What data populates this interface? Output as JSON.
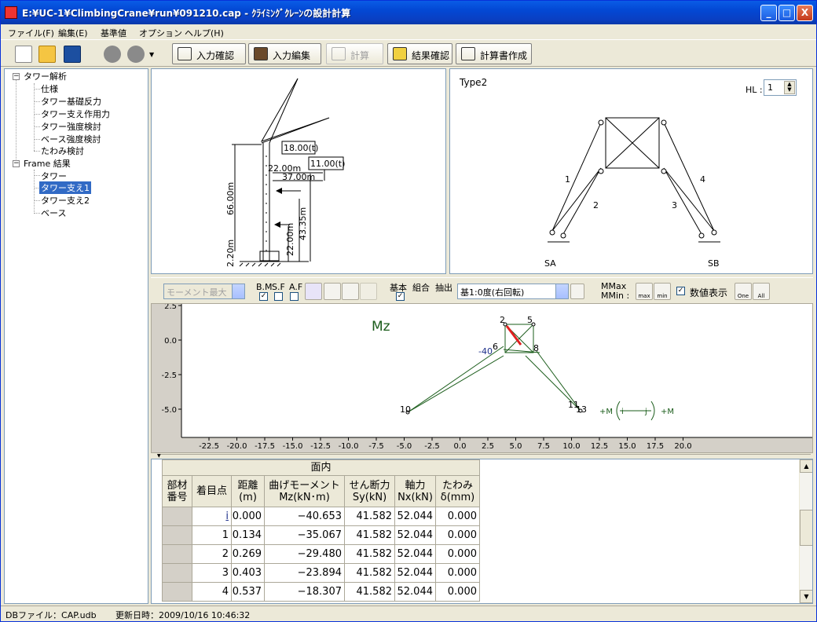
{
  "window": {
    "title": "E:¥UC-1¥ClimbingCrane¥run¥091210.cap - ｸﾗｲﾐﾝｸﾞｸﾚｰﾝの設計計算",
    "min": "_",
    "max": "□",
    "close": "X"
  },
  "menu": {
    "file": "ファイル(F)",
    "edit": "編集(E)",
    "base": "基準値",
    "options": "オプション",
    "help": "ヘルプ(H)"
  },
  "toolbar": {
    "input_check": "入力確認",
    "input_edit": "入力編集",
    "calc": "計算",
    "result_check": "結果確認",
    "report": "計算書作成"
  },
  "tree": {
    "root1": "タワー解析",
    "children1": [
      "仕様",
      "タワー基礎反力",
      "タワー支え作用力",
      "タワー強度検討",
      "ベース強度検討",
      "たわみ検討"
    ],
    "root2": "Frame 結果",
    "children2": [
      "タワー",
      "タワー支え1",
      "タワー支え2",
      "ベース"
    ],
    "selected": "タワー支え1"
  },
  "crane": {
    "load1": "18.00(t)",
    "load2": "11.00(t)",
    "r1": "22.00m",
    "r2": "37.00m",
    "h_total": "66.00m",
    "h_support": "43.35m",
    "h_lower": "22.00m",
    "h_base": "2.20m"
  },
  "frame": {
    "type": "Type2",
    "hl_label": "HL :",
    "hl_value": "1",
    "members": [
      "1",
      "2",
      "3",
      "4"
    ],
    "supports": [
      "SA",
      "SB"
    ]
  },
  "result_toolbar": {
    "moment_combo": "モーメント最大",
    "bm": "B.M",
    "sf": "S.F",
    "af": "A.F",
    "basic": "基本",
    "combo": "組合",
    "extract": "抽出",
    "case": "基1:0度(右回転)",
    "mmax": "MMax",
    "mmin": "MMin :",
    "show_values": "数値表示",
    "max": "max",
    "min": "min",
    "one": "One",
    "all": "All"
  },
  "plot": {
    "label": "Mz",
    "y_ticks": [
      "2.5",
      "0.0",
      "-2.5",
      "-5.0"
    ],
    "x_ticks": [
      "-22.5",
      "-20.0",
      "-17.5",
      "-15.0",
      "-12.5",
      "-10.0",
      "-7.5",
      "-5.0",
      "-2.5",
      "0.0",
      "2.5",
      "5.0",
      "7.5",
      "10.0",
      "12.5",
      "15.0",
      "17.5",
      "20.0"
    ],
    "node_labels": [
      "2",
      "5",
      "-40",
      "6",
      "8",
      "10",
      "11",
      "13"
    ],
    "legend_left": "+M",
    "legend_i": "i",
    "legend_j": "j",
    "legend_right": "+M"
  },
  "table": {
    "group": "面内",
    "headers": [
      "部材\n番号",
      "着目点",
      "距離\n(m)",
      "曲げモーメント\nMz(kN･m)",
      "せん断力\nSy(kN)",
      "軸力\nNx(kN)",
      "たわみ\nδ(mm)"
    ],
    "rows": [
      {
        "point": "i",
        "dist": "0.000",
        "mz": "−40.653",
        "sy": "41.582",
        "nx": "52.044",
        "d": "0.000"
      },
      {
        "point": "1",
        "dist": "0.134",
        "mz": "−35.067",
        "sy": "41.582",
        "nx": "52.044",
        "d": "0.000"
      },
      {
        "point": "2",
        "dist": "0.269",
        "mz": "−29.480",
        "sy": "41.582",
        "nx": "52.044",
        "d": "0.000"
      },
      {
        "point": "3",
        "dist": "0.403",
        "mz": "−23.894",
        "sy": "41.582",
        "nx": "52.044",
        "d": "0.000"
      },
      {
        "point": "4",
        "dist": "0.537",
        "mz": "−18.307",
        "sy": "41.582",
        "nx": "52.044",
        "d": "0.000"
      }
    ]
  },
  "status": {
    "db": "DBファイル：CAP.udb",
    "updated": "更新日時：2009/10/16 10:46:32"
  }
}
